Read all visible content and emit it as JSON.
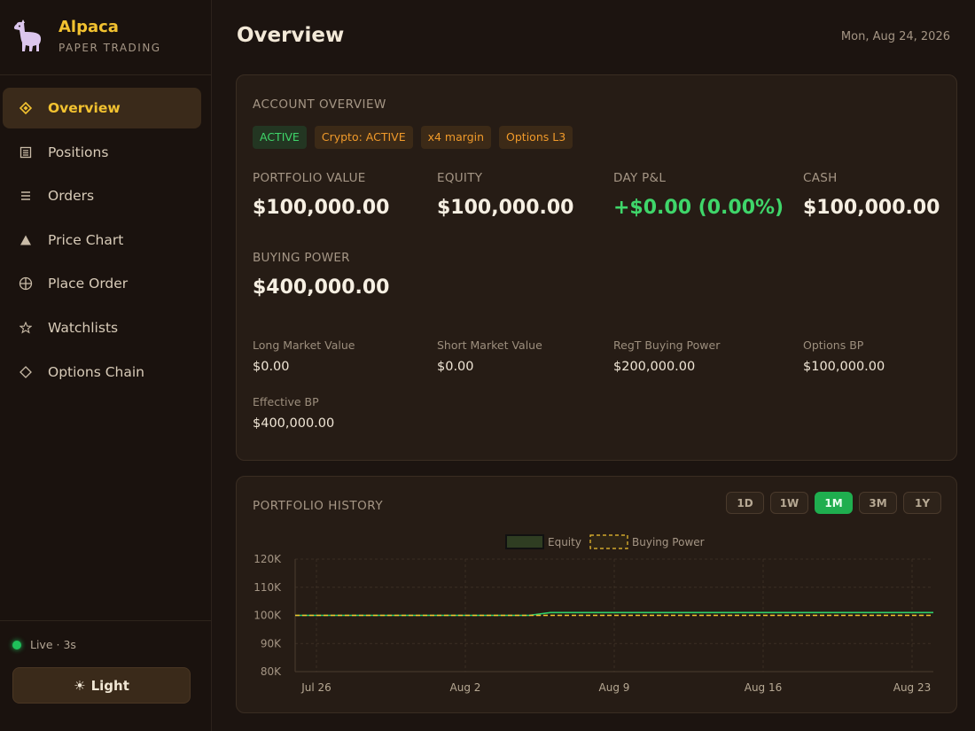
{
  "brand": {
    "name": "Alpaca",
    "subtitle": "PAPER TRADING"
  },
  "nav": [
    {
      "label": "Overview",
      "icon": "diamond-icon",
      "active": true
    },
    {
      "label": "Positions",
      "icon": "list-icon",
      "active": false
    },
    {
      "label": "Orders",
      "icon": "lines-icon",
      "active": false
    },
    {
      "label": "Price Chart",
      "icon": "triangle-icon",
      "active": false
    },
    {
      "label": "Place Order",
      "icon": "crosshair-icon",
      "active": false
    },
    {
      "label": "Watchlists",
      "icon": "star-icon",
      "active": false
    },
    {
      "label": "Options Chain",
      "icon": "diamond-outline-icon",
      "active": false
    }
  ],
  "status": {
    "live": "Live · 3s"
  },
  "theme_button": {
    "label": "Light"
  },
  "header": {
    "title": "Overview",
    "date": "Mon, Aug 24, 2026"
  },
  "account": {
    "title": "ACCOUNT OVERVIEW",
    "badges": [
      {
        "text": "ACTIVE",
        "tone": "green"
      },
      {
        "text": "Crypto: ACTIVE",
        "tone": "orange"
      },
      {
        "text": "x4 margin",
        "tone": "orange"
      },
      {
        "text": "Options L3",
        "tone": "orange"
      }
    ],
    "metrics": [
      {
        "label": "PORTFOLIO VALUE",
        "value": "$100,000.00"
      },
      {
        "label": "EQUITY",
        "value": "$100,000.00"
      },
      {
        "label": "DAY P&L",
        "value": "+$0.00 (0.00%)"
      },
      {
        "label": "CASH",
        "value": "$100,000.00"
      },
      {
        "label": "BUYING POWER",
        "value": "$400,000.00"
      }
    ],
    "details": [
      {
        "label": "Long Market Value",
        "value": "$0.00"
      },
      {
        "label": "Short Market Value",
        "value": "$0.00"
      },
      {
        "label": "RegT Buying Power",
        "value": "$200,000.00"
      },
      {
        "label": "Options BP",
        "value": "$100,000.00"
      },
      {
        "label": "Effective BP",
        "value": "$400,000.00"
      }
    ]
  },
  "history": {
    "title": "PORTFOLIO HISTORY",
    "ranges": [
      "1D",
      "1W",
      "1M",
      "3M",
      "1Y"
    ],
    "active_range": "1M"
  },
  "chart_data": {
    "type": "line",
    "legend_placement": "top-center",
    "grid": true,
    "ylim": [
      80000,
      120000
    ],
    "yticks": [
      {
        "value": 120000,
        "label": "120K"
      },
      {
        "value": 110000,
        "label": "110K"
      },
      {
        "value": 100000,
        "label": "100K"
      },
      {
        "value": 90000,
        "label": "90K"
      },
      {
        "value": 80000,
        "label": "80K"
      }
    ],
    "xlim": [
      "2026-07-25",
      "2026-08-24"
    ],
    "xticks": [
      {
        "date": "2026-07-26",
        "label": "Jul 26"
      },
      {
        "date": "2026-08-02",
        "label": "Aug 2"
      },
      {
        "date": "2026-08-09",
        "label": "Aug 9"
      },
      {
        "date": "2026-08-16",
        "label": "Aug 16"
      },
      {
        "date": "2026-08-23",
        "label": "Aug 23"
      }
    ],
    "series": [
      {
        "name": "Equity",
        "color": "#2fcf6a",
        "style": "solid",
        "points": [
          {
            "x": "2026-07-25",
            "y": 100000
          },
          {
            "x": "2026-08-05",
            "y": 100000
          },
          {
            "x": "2026-08-06",
            "y": 101000
          },
          {
            "x": "2026-08-24",
            "y": 101000
          }
        ]
      },
      {
        "name": "Buying Power",
        "color": "#f2c230",
        "style": "dashed",
        "points": [
          {
            "x": "2026-07-25",
            "y": 100000
          },
          {
            "x": "2026-08-24",
            "y": 100000
          }
        ]
      }
    ]
  },
  "colors": {
    "accent": "#f2c230",
    "positive": "#3fd66a",
    "active_range": "#1fae4f"
  }
}
